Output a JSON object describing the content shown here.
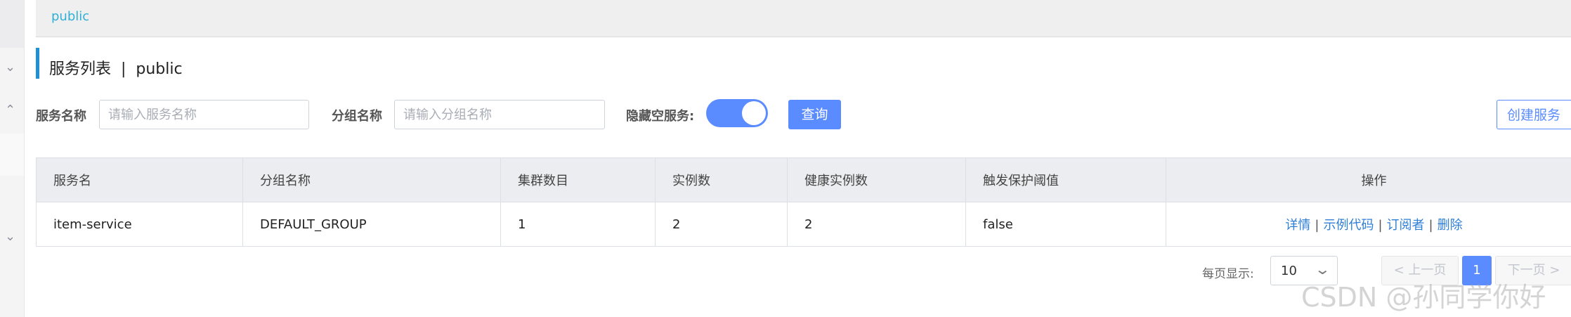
{
  "namespace_bar": {
    "label": "public"
  },
  "page_title": "服务列表  |  public",
  "filters": {
    "service_name_label": "服务名称",
    "service_name_placeholder": "请输入服务名称",
    "group_name_label": "分组名称",
    "group_name_placeholder": "请输入分组名称",
    "hide_empty_label": "隐藏空服务:",
    "hide_empty_on": true,
    "query_button": "查询",
    "create_button": "创建服务"
  },
  "table": {
    "columns": [
      "服务名",
      "分组名称",
      "集群数目",
      "实例数",
      "健康实例数",
      "触发保护阈值",
      "操作"
    ],
    "rows": [
      {
        "service": "item-service",
        "group": "DEFAULT_GROUP",
        "clusters": "1",
        "instances": "2",
        "healthy": "2",
        "threshold": "false",
        "ops": [
          "详情",
          "示例代码",
          "订阅者",
          "删除"
        ]
      }
    ],
    "ops_separator": "|"
  },
  "pagination": {
    "page_size_label": "每页显示:",
    "page_size": "10",
    "prev": "< 上一页",
    "current_page": "1",
    "next": "下一页 >"
  },
  "icons": {
    "sidebar_chevrons": [
      "chevron-down-icon",
      "chevron-up-icon",
      "chevron-down-icon"
    ],
    "select_arrow": "chevron-down-icon"
  },
  "colors": {
    "accent": "#5b8cff",
    "link": "#2f7fd6",
    "namespace": "#31b0d5"
  },
  "watermark": "CSDN @孙同学你好"
}
